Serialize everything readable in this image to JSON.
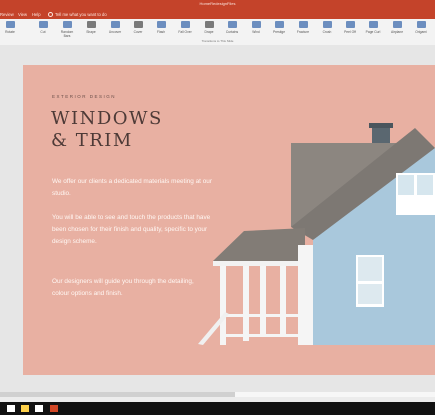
{
  "window": {
    "title": "HomeRedesignFiles"
  },
  "menubar": {
    "items": [
      "Review",
      "View",
      "Help"
    ],
    "tell_me": "Tell me what you want to do"
  },
  "ribbon": {
    "buttons": [
      {
        "label": "Rotate",
        "color": "#6c8ebf"
      },
      {
        "label": "Cut",
        "color": "#6c8ebf"
      },
      {
        "label": "Random Bars",
        "color": "#6c8ebf"
      },
      {
        "label": "Shape",
        "color": "#7a7a7a"
      },
      {
        "label": "Uncover",
        "color": "#6c8ebf"
      },
      {
        "label": "Cover",
        "color": "#7a7a7a"
      },
      {
        "label": "Flash",
        "color": "#6c8ebf"
      },
      {
        "label": "Fall Over",
        "color": "#6c8ebf"
      },
      {
        "label": "Drape",
        "color": "#7a7a7a"
      },
      {
        "label": "Curtains",
        "color": "#6c8ebf"
      },
      {
        "label": "Wind",
        "color": "#6c8ebf"
      },
      {
        "label": "Prestige",
        "color": "#6c8ebf"
      },
      {
        "label": "Fracture",
        "color": "#6c8ebf"
      },
      {
        "label": "Crush",
        "color": "#6c8ebf"
      },
      {
        "label": "Peel Off",
        "color": "#6c8ebf"
      },
      {
        "label": "Page Curl",
        "color": "#6c8ebf"
      },
      {
        "label": "Airplane",
        "color": "#6c8ebf"
      },
      {
        "label": "Origami",
        "color": "#6c8ebf"
      }
    ],
    "group_label": "Transitions to This Slide"
  },
  "slide": {
    "kicker": "EXTERIOR DESIGN",
    "title_line1": "WINDOWS",
    "title_line2": "& TRIM",
    "paragraphs": [
      "We offer our clients a dedicated materials meeting at our studio.",
      "You will be able to see and touch the products that have been chosen for their finish and quality, specific to your design scheme.",
      "Our designers will guide you through the detailing, colour options and finish."
    ],
    "background": "#e8b0a2"
  },
  "taskbar": {
    "items": [
      {
        "icon": "windows-start-icon",
        "color": "#ffffff"
      },
      {
        "icon": "file-explorer-icon",
        "color": "#ffd24a"
      },
      {
        "icon": "store-icon",
        "color": "#ffffff"
      },
      {
        "icon": "powerpoint-icon",
        "color": "#d24726"
      }
    ]
  }
}
